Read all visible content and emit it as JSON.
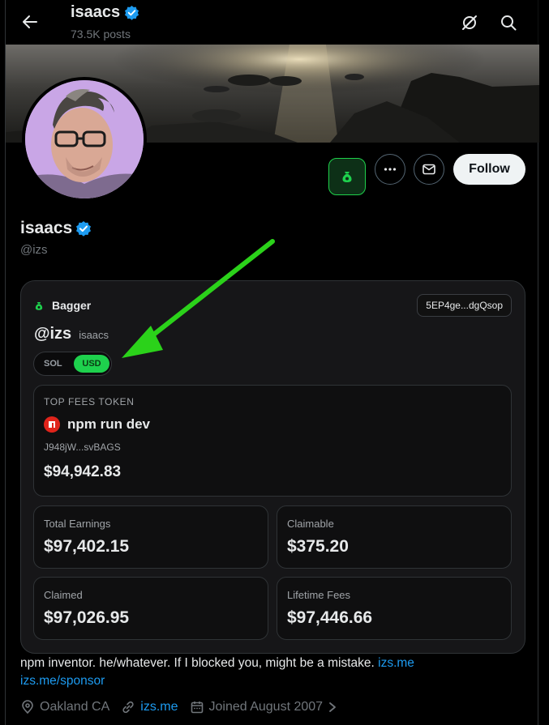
{
  "header": {
    "name": "isaacs",
    "posts": "73.5K posts"
  },
  "profile": {
    "name": "isaacs",
    "handle": "@izs",
    "follow_label": "Follow"
  },
  "bagger_card": {
    "brand": "Bagger",
    "address": "5EP4ge...dgQsop",
    "user_handle": "@izs",
    "user_name": "isaacs",
    "currency_options": [
      "SOL",
      "USD"
    ],
    "selected_currency": "USD",
    "top_token": {
      "label": "TOP FEES TOKEN",
      "name": "npm run dev",
      "mint": "J948jW...svBAGS",
      "value": "$94,942.83"
    },
    "stats": [
      {
        "label": "Total Earnings",
        "value": "$97,402.15"
      },
      {
        "label": "Claimable",
        "value": "$375.20"
      },
      {
        "label": "Claimed",
        "value": "$97,026.95"
      },
      {
        "label": "Lifetime Fees",
        "value": "$97,446.66"
      }
    ]
  },
  "bio": {
    "text": "npm inventor. he/whatever. If I blocked you, might be a mistake.",
    "link1": "izs.me",
    "link2": "izs.me/sponsor"
  },
  "meta": {
    "location": "Oakland CA",
    "website": "izs.me",
    "joined": "Joined August 2007"
  },
  "colors": {
    "accent_blue": "#1d9bf0",
    "bagger_green": "#1ed14d",
    "annotation_arrow": "#2bd21a"
  },
  "icons": [
    "back-arrow-icon",
    "verified-badge-icon",
    "grok-icon",
    "search-icon",
    "money-bag-icon",
    "more-icon",
    "message-icon",
    "location-icon",
    "link-icon",
    "calendar-icon",
    "chevron-right-icon",
    "npm-icon"
  ]
}
